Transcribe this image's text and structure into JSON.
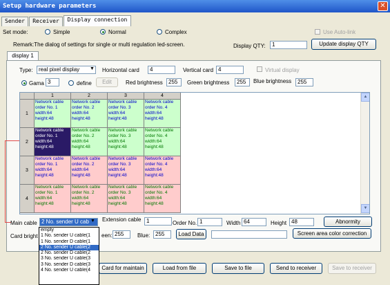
{
  "window": {
    "title": "Setup hardware parameters",
    "close": "✕"
  },
  "tabs": [
    "Sender",
    "Receiver",
    "Display connection"
  ],
  "set_mode": {
    "label": "Set mode:",
    "options": [
      "Simple",
      "Normal",
      "Complex"
    ],
    "selected": "Normal"
  },
  "use_autolink": "Use Auto-link",
  "remark": "Remark:The dialog of settings for single or multi  regulation led-screen.",
  "display_qty": {
    "label": "Display QTY:",
    "value": "1"
  },
  "update_btn": "Update display QTY",
  "subtab": "display 1",
  "type": {
    "label": "Type:",
    "value": "real pixel display"
  },
  "hcard": {
    "label": "Horizontal card",
    "value": "4"
  },
  "vcard": {
    "label": "Vertical card",
    "value": "4"
  },
  "virtual_display": "Virtual display",
  "gama": {
    "label": "Gama",
    "value": "3"
  },
  "define": "define",
  "edit_btn": "Edit",
  "red_brightness": {
    "label": "Red brightness",
    "value": "255"
  },
  "green_brightness": {
    "label": "Green brightness",
    "value": "255"
  },
  "blue_brightness": {
    "label": "Blue brightness",
    "value": "255"
  },
  "grid": {
    "col_headers": [
      "1",
      "2",
      "3",
      "4"
    ],
    "row_headers": [
      "1",
      "2",
      "3",
      "4"
    ],
    "cells": [
      [
        {
          "l1": "Network cable",
          "l2": "order No. 1",
          "l3": "width:64",
          "l4": "height:48"
        },
        {
          "l1": "Network cable",
          "l2": "order No. 2",
          "l3": "width:64",
          "l4": "height:48"
        },
        {
          "l1": "Network cable",
          "l2": "order No. 3",
          "l3": "width:64",
          "l4": "height:48"
        },
        {
          "l1": "Network cable",
          "l2": "order No. 4",
          "l3": "width:64",
          "l4": "height:48"
        }
      ],
      [
        {
          "l1": "Network cable",
          "l2": "order No. 1",
          "l3": "width:64",
          "l4": "height:48"
        },
        {
          "l1": "Network cable",
          "l2": "order No. 2",
          "l3": "width:64",
          "l4": "height:48"
        },
        {
          "l1": "Network cable",
          "l2": "order No. 3",
          "l3": "width:64",
          "l4": "height:48"
        },
        {
          "l1": "Network cable",
          "l2": "order No. 4",
          "l3": "width:64",
          "l4": "height:48"
        }
      ],
      [
        {
          "l1": "Network cable",
          "l2": "order No. 1",
          "l3": "width:64",
          "l4": "height:48"
        },
        {
          "l1": "Network cable",
          "l2": "order No. 2",
          "l3": "width:64",
          "l4": "height:48"
        },
        {
          "l1": "Network cable",
          "l2": "order No. 3",
          "l3": "width:64",
          "l4": "height:48"
        },
        {
          "l1": "Network cable",
          "l2": "order No. 4",
          "l3": "width:64",
          "l4": "height:48"
        }
      ],
      [
        {
          "l1": "Network cable",
          "l2": "order No. 1",
          "l3": "width:64",
          "l4": "height:48"
        },
        {
          "l1": "Network cable",
          "l2": "order No. 2",
          "l3": "width:64",
          "l4": "height:48"
        },
        {
          "l1": "Network cable",
          "l2": "order No. 3",
          "l3": "width:64",
          "l4": "height:48"
        },
        {
          "l1": "Network cable",
          "l2": "order No. 4",
          "l3": "width:64",
          "l4": "height:48"
        }
      ]
    ]
  },
  "main_cable": {
    "label": "Main cable",
    "value": "2 No. sender U cab"
  },
  "extension_cable": {
    "label": "Extension cable",
    "value": "1"
  },
  "order_no": {
    "label": "Order No.",
    "value": "1"
  },
  "width": {
    "label": "Width",
    "value": "64"
  },
  "height": {
    "label": "Height",
    "value": "48"
  },
  "abnormity_btn": "Abnormity",
  "card_bright": {
    "label": "Card bright"
  },
  "green_short": {
    "label": "een:",
    "value": "255"
  },
  "blue_short": {
    "label": "Blue:",
    "value": "255"
  },
  "load_data_btn": "Load Data",
  "screen_area_btn": "Screen area color correction",
  "dropdown_items": [
    "empty",
    "1 No. sender U cable(1",
    "1 No. sender D cable(1",
    "2 No. sender U cable(2",
    "2 No. sender D cable(2",
    "3 No. sender U cable(3",
    "3 No. sender D cable(3",
    "4 No. sender U cable(4"
  ],
  "dropdown_selected_index": 3,
  "bottom_buttons": {
    "card_maintain": "Card for maintain",
    "load_file": "Load from file",
    "save_file": "Save to file",
    "send_receiver": "Send to receiver",
    "save_receiver": "Save to receiver"
  }
}
